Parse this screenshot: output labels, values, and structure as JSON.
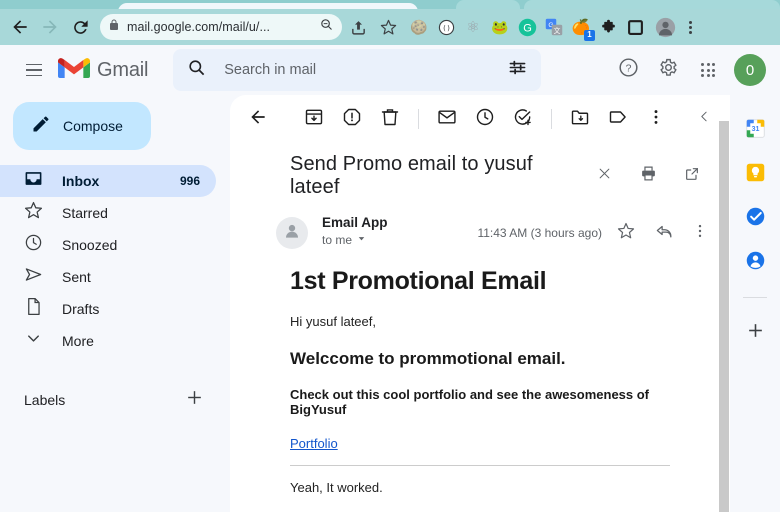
{
  "browser": {
    "back_icon": "back-arrow-icon",
    "forward_icon": "forward-arrow-icon",
    "reload_icon": "reload-icon",
    "lock_icon": "lock-icon",
    "url": "mail.google.com/mail/u/...",
    "zoom_icon": "zoom-out-icon",
    "share_icon": "share-icon",
    "bookmark_icon": "star-icon",
    "extensions": [
      {
        "name": "extension-cookie",
        "glyph": "🍪"
      },
      {
        "name": "extension-bracket",
        "glyph": "()"
      },
      {
        "name": "extension-react",
        "glyph": "⚛"
      },
      {
        "name": "extension-frog",
        "glyph": "🐸"
      },
      {
        "name": "extension-grammarly",
        "glyph": "G"
      },
      {
        "name": "extension-google-translate",
        "glyph": "G文"
      },
      {
        "name": "extension-orange",
        "glyph": "🍊",
        "badge": "1"
      },
      {
        "name": "extension-puzzle",
        "glyph": "🧩"
      },
      {
        "name": "extension-square",
        "glyph": "◻"
      }
    ],
    "profile_icon": "profile-avatar-icon",
    "menu_icon": "chrome-menu-icon"
  },
  "header": {
    "menu_icon": "hamburger-menu-icon",
    "logo_icon": "gmail-logo-icon",
    "logo_text": "Gmail",
    "search": {
      "icon": "search-icon",
      "placeholder": "Search in mail",
      "value": "",
      "options_icon": "search-options-icon"
    },
    "support_icon": "help-icon",
    "settings_icon": "gear-icon",
    "apps_icon": "google-apps-grid-icon",
    "avatar_letter": "0",
    "avatar_color": "#57a05a"
  },
  "sidebar": {
    "compose": {
      "label": "Compose",
      "icon": "pencil-icon",
      "bg": "#c2e7ff"
    },
    "items": [
      {
        "label": "Inbox",
        "icon": "inbox-icon",
        "count": "996",
        "active": true
      },
      {
        "label": "Starred",
        "icon": "star-icon",
        "count": "",
        "active": false
      },
      {
        "label": "Snoozed",
        "icon": "clock-icon",
        "count": "",
        "active": false
      },
      {
        "label": "Sent",
        "icon": "send-icon",
        "count": "",
        "active": false
      },
      {
        "label": "Drafts",
        "icon": "draft-icon",
        "count": "",
        "active": false
      },
      {
        "label": "More",
        "icon": "chevron-down-icon",
        "count": "",
        "active": false
      }
    ],
    "labels_title": "Labels",
    "labels_add_icon": "plus-icon"
  },
  "mail_toolbar": {
    "buttons": [
      {
        "name": "back-to-inbox-button",
        "icon": "back-arrow-icon"
      },
      {
        "name": "archive-button",
        "icon": "archive-icon"
      },
      {
        "name": "report-spam-button",
        "icon": "report-spam-icon"
      },
      {
        "name": "delete-button",
        "icon": "trash-icon"
      },
      {
        "name": "mark-unread-button",
        "icon": "envelope-icon"
      },
      {
        "name": "snooze-button",
        "icon": "clock-icon"
      },
      {
        "name": "add-to-tasks-button",
        "icon": "add-task-icon"
      },
      {
        "name": "move-to-button",
        "icon": "move-to-folder-icon"
      },
      {
        "name": "labels-button",
        "icon": "label-tag-icon"
      },
      {
        "name": "more-options-button",
        "icon": "more-vertical-icon"
      }
    ],
    "collapse_icon": "chevron-left-icon"
  },
  "message": {
    "subject": "Send Promo email to yusuf lateef",
    "subject_actions": [
      {
        "name": "collapse-all-button",
        "icon": "collapse-icon"
      },
      {
        "name": "print-button",
        "icon": "printer-icon"
      },
      {
        "name": "open-in-new-window-button",
        "icon": "open-in-new-icon"
      }
    ],
    "sender_avatar_icon": "person-avatar-icon",
    "sender_name": "Email App",
    "recipient": "to me",
    "recipient_caret_icon": "chevron-down-icon",
    "timestamp": "11:43 AM (3 hours ago)",
    "star_icon": "star-icon",
    "reply_icon": "reply-icon",
    "more_icon": "more-vertical-icon",
    "body": {
      "heading": "1st Promotional Email",
      "greeting": "Hi yusuf lateef,",
      "subheading": "Welccome to prommotional email.",
      "paragraph": "Check out this cool portfolio and see the awesomeness of BigYusuf",
      "link_text": "Portfolio",
      "closing": "Yeah, It worked."
    }
  },
  "side_panel": {
    "items": [
      {
        "name": "google-calendar-icon",
        "label": "31"
      },
      {
        "name": "google-keep-icon",
        "label": ""
      },
      {
        "name": "google-tasks-icon",
        "label": ""
      },
      {
        "name": "google-contacts-icon",
        "label": ""
      }
    ],
    "add_on_icon": "plus-icon"
  }
}
